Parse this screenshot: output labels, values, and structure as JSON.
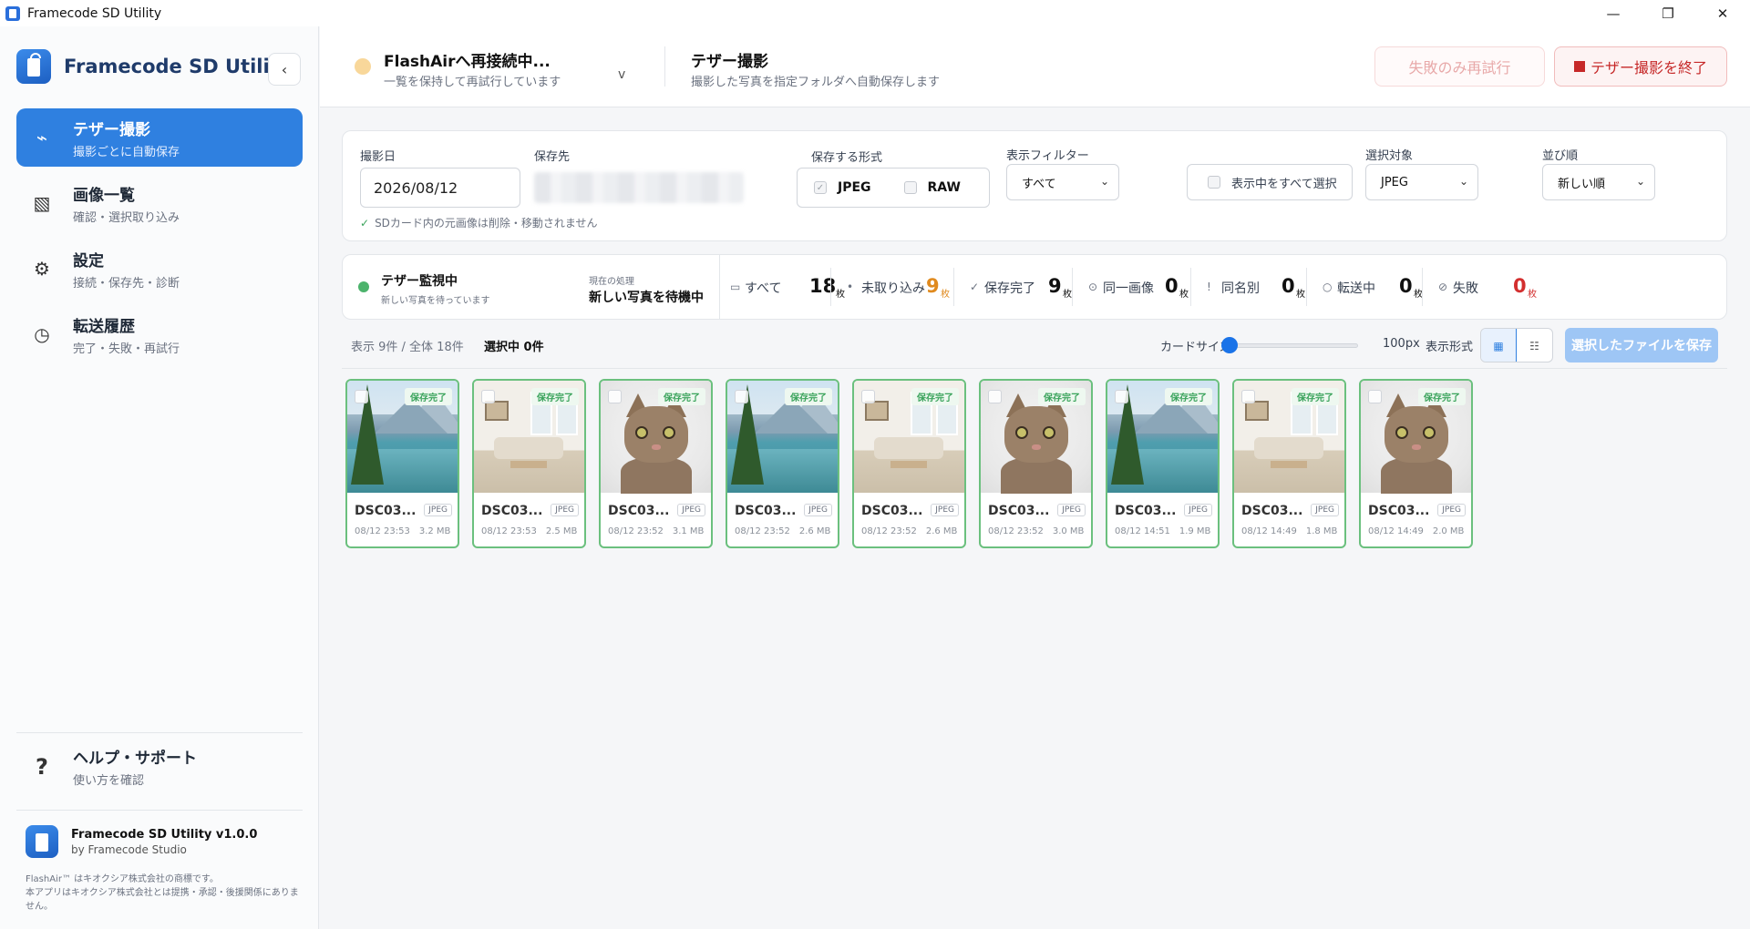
{
  "window": {
    "title": "Framecode SD Utility",
    "controls": [
      "—",
      "❐",
      "✕"
    ]
  },
  "sidebar": {
    "brand": "Framecode SD Utility",
    "collapse_icon": "‹",
    "items": [
      {
        "title": "テザー撮影",
        "sub": "撮影ごとに自動保存",
        "icon": "⌁"
      },
      {
        "title": "画像一覧",
        "sub": "確認・選択取り込み",
        "icon": "▧"
      },
      {
        "title": "設定",
        "sub": "接続・保存先・診断",
        "icon": "⚙"
      },
      {
        "title": "転送履歴",
        "sub": "完了・失敗・再試行",
        "icon": "◷"
      }
    ],
    "help": {
      "title": "ヘルプ・サポート",
      "sub": "使い方を確認",
      "icon": "?"
    },
    "about": {
      "name": "Framecode SD Utility v1.0.0",
      "by": "by Framecode Studio",
      "legal1": "FlashAir™ はキオクシア株式会社の商標です。",
      "legal2": "本アプリはキオクシア株式会社とは提携・承認・後援関係にありません。"
    }
  },
  "header": {
    "connection_title": "FlashAirへ再接続中...",
    "connection_sub": "一覧を保持して再試行しています",
    "chevron": "v",
    "mode_title": "テザー撮影",
    "mode_sub": "撮影した写真を指定フォルダへ自動保存します",
    "retry_label": "失敗のみ再試行",
    "stop_label": "テザー撮影を終了"
  },
  "settings": {
    "date_label": "撮影日",
    "date_value": "2026/08/12",
    "dest_label": "保存先",
    "note": "SDカード内の元画像は削除・移動されません",
    "note_check": "✓",
    "format_label": "保存する形式",
    "format_jpeg": "JPEG",
    "format_raw": "RAW",
    "filter_label": "表示フィルター",
    "filter_value": "すべて",
    "select_all_label": "表示中をすべて選択",
    "target_label": "選択対象",
    "target_value": "JPEG",
    "sort_label": "並び順",
    "sort_value": "新しい順"
  },
  "status": {
    "monitor_title": "テザー監視中",
    "monitor_sub": "新しい写真を待っています",
    "process_label": "現在の処理",
    "process_value": "新しい写真を待機中",
    "unit": "枚",
    "stats": [
      {
        "icon": "▭",
        "label": "すべて",
        "value": "18",
        "color": "#111111"
      },
      {
        "icon": "•",
        "label": "未取り込み",
        "value": "9",
        "color": "#e08a1e"
      },
      {
        "icon": "✓",
        "label": "保存完了",
        "value": "9",
        "color": "#111111"
      },
      {
        "icon": "⊙",
        "label": "同一画像",
        "value": "0",
        "color": "#111111"
      },
      {
        "icon": "!",
        "label": "同名別",
        "value": "0",
        "color": "#111111"
      },
      {
        "icon": "○",
        "label": "転送中",
        "value": "0",
        "color": "#111111"
      },
      {
        "icon": "⊘",
        "label": "失敗",
        "value": "0",
        "color": "#d32f2f"
      }
    ]
  },
  "toolbar": {
    "count_text": "表示 9件 / 全体 18件",
    "selected_text": "選択中 0件",
    "card_size_label": "カードサイズ",
    "card_size_value": "100px",
    "card_size_fraction": 0.0,
    "view_label": "表示形式",
    "view_grid_icon": "▦",
    "view_list_icon": "☷",
    "save_label": "選択したファイルを保存"
  },
  "cards": [
    {
      "name": "DSC03...",
      "type": "JPEG",
      "date": "08/12 23:53",
      "size": "3.2 MB",
      "badge": "保存完了",
      "image": "mountain"
    },
    {
      "name": "DSC03...",
      "type": "JPEG",
      "date": "08/12 23:53",
      "size": "2.5 MB",
      "badge": "保存完了",
      "image": "room"
    },
    {
      "name": "DSC03...",
      "type": "JPEG",
      "date": "08/12 23:52",
      "size": "3.1 MB",
      "badge": "保存完了",
      "image": "cat"
    },
    {
      "name": "DSC03...",
      "type": "JPEG",
      "date": "08/12 23:52",
      "size": "2.6 MB",
      "badge": "保存完了",
      "image": "mountain"
    },
    {
      "name": "DSC03...",
      "type": "JPEG",
      "date": "08/12 23:52",
      "size": "2.6 MB",
      "badge": "保存完了",
      "image": "room"
    },
    {
      "name": "DSC03...",
      "type": "JPEG",
      "date": "08/12 23:52",
      "size": "3.0 MB",
      "badge": "保存完了",
      "image": "cat"
    },
    {
      "name": "DSC03...",
      "type": "JPEG",
      "date": "08/12 14:51",
      "size": "1.9 MB",
      "badge": "保存完了",
      "image": "mountain"
    },
    {
      "name": "DSC03...",
      "type": "JPEG",
      "date": "08/12 14:49",
      "size": "1.8 MB",
      "badge": "保存完了",
      "image": "room"
    },
    {
      "name": "DSC03...",
      "type": "JPEG",
      "date": "08/12 14:49",
      "size": "2.0 MB",
      "badge": "保存完了",
      "image": "cat"
    }
  ]
}
